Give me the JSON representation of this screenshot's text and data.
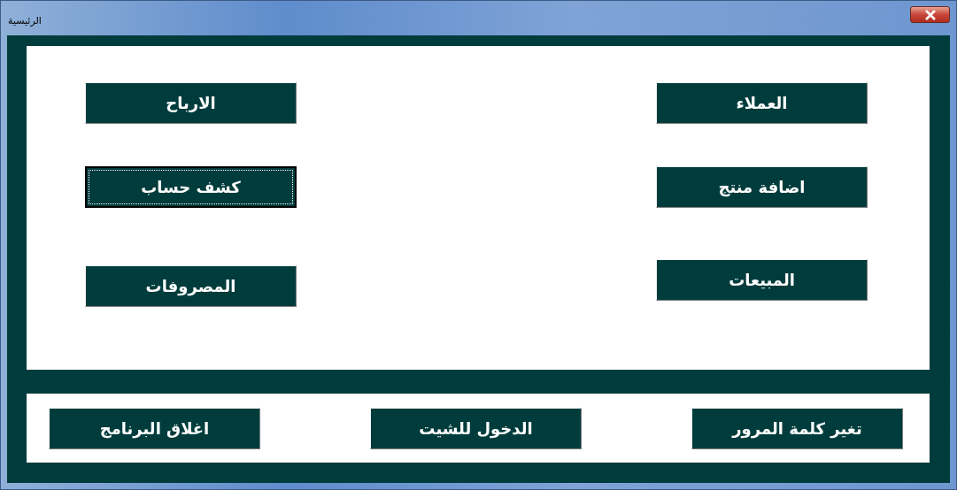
{
  "window": {
    "title": "الرئيسية"
  },
  "main_panel": {
    "columns": [
      [
        {
          "label": "العملاء",
          "focused": false
        },
        {
          "label": "اضافة منتج",
          "focused": false
        },
        {
          "label": "المبيعات",
          "focused": false
        }
      ],
      [
        {
          "label": "الارباح",
          "focused": false
        },
        {
          "label": "كشف حساب",
          "focused": true
        },
        {
          "label": "المصروفات",
          "focused": false
        }
      ]
    ]
  },
  "bottom_buttons": [
    {
      "label": "تغير كلمة المرور",
      "focused": false
    },
    {
      "label": "الدخول للشيت",
      "focused": false
    },
    {
      "label": "اغلاق البرنامج",
      "focused": false
    }
  ]
}
